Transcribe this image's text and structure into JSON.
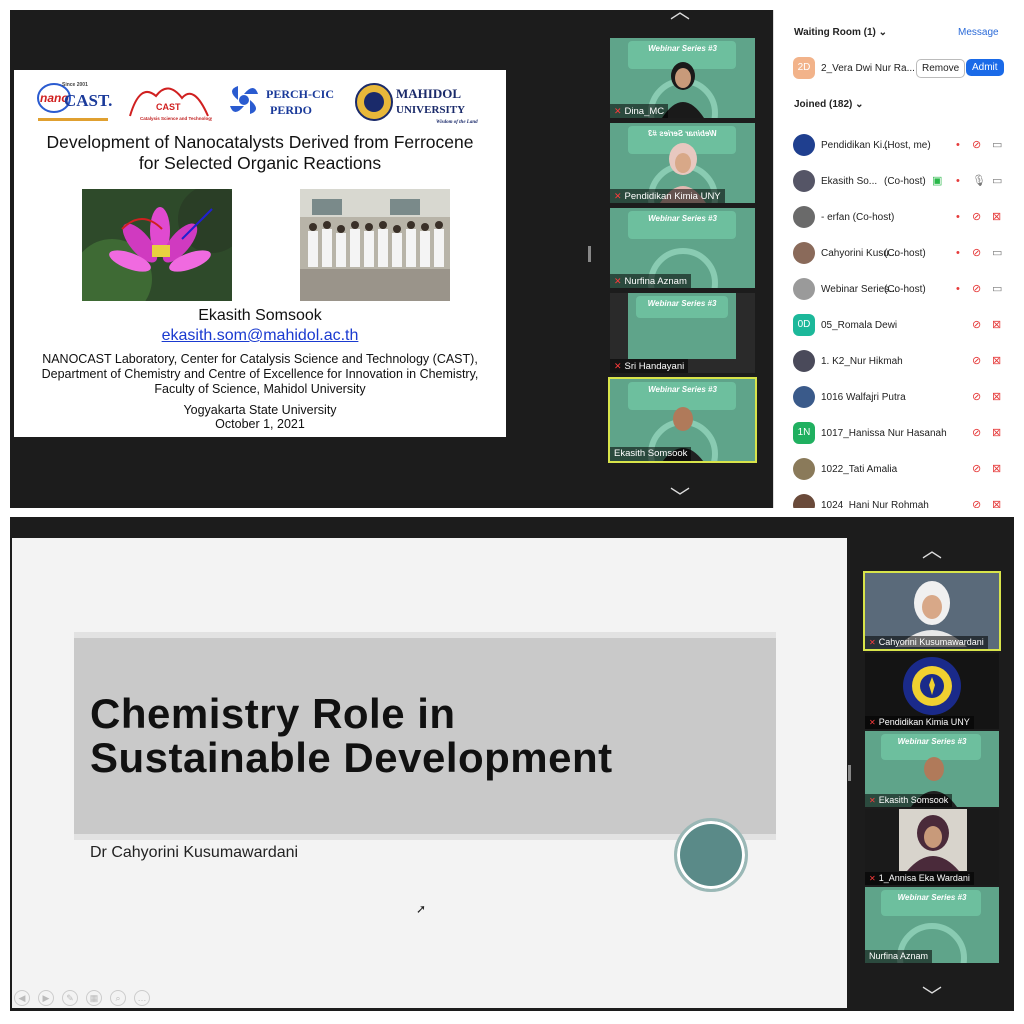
{
  "top": {
    "slide": {
      "logos": [
        "nano CAST.",
        "CAST",
        "PERCH-CIC",
        "PERDO",
        "MAHIDOL",
        "UNIVERSITY",
        "Wisdom of the Land"
      ],
      "title_line1": "Development of Nanocatalysts Derived from Ferrocene",
      "title_line2": "for Selected Organic Reactions",
      "author": "Ekasith Somsook",
      "email": "ekasith.som@mahidol.ac.th",
      "affil1": "NANOCAST Laboratory, Center for Catalysis Science and Technology (CAST),",
      "affil2": "Department of Chemistry and Centre of Excellence for Innovation in Chemistry,",
      "affil3": "Faculty of Science, Mahidol University",
      "venue": "Yogyakarta State University",
      "date": "October 1, 2021"
    },
    "tiles": [
      {
        "name": "Dina_MC"
      },
      {
        "name": "Pendidikan Kimia UNY"
      },
      {
        "name": "Nurfina Aznam"
      },
      {
        "name": "Sri Handayani"
      },
      {
        "name": "Ekasith Somsook"
      }
    ],
    "tile_banner": "Webinar Series #3",
    "panel": {
      "waiting_room": "Waiting Room (1)",
      "message": "Message",
      "waiting": {
        "initials": "2D",
        "name": "2_Vera Dwi Nur Ra...",
        "remove": "Remove",
        "admit": "Admit"
      },
      "joined": "Joined (182)",
      "participants": [
        {
          "initials": "",
          "name": "Pendidikan Ki...",
          "role": "(Host, me)",
          "color": "#1f3f8f"
        },
        {
          "initials": "",
          "name": "Ekasith So...",
          "role": "(Co-host)",
          "color": "#556"
        },
        {
          "initials": "",
          "name": "- erfan (Co-host)",
          "role": "",
          "color": "#6a6a6a"
        },
        {
          "initials": "",
          "name": "Cahyorini Kusu...",
          "role": "(Co-host)",
          "color": "#8a6a5a"
        },
        {
          "initials": "",
          "name": "Webinar Series...",
          "role": "(Co-host)",
          "color": "#9a9a9a"
        },
        {
          "initials": "0D",
          "name": "05_Romala Dewi",
          "role": "",
          "color": "#1cb89a"
        },
        {
          "initials": "",
          "name": "1. K2_Nur Hikmah",
          "role": "",
          "color": "#4a4a5a"
        },
        {
          "initials": "",
          "name": "1016 Walfajri Putra",
          "role": "",
          "color": "#3a5a8a"
        },
        {
          "initials": "1N",
          "name": "1017_Hanissa Nur Hasanah",
          "role": "",
          "color": "#20b060"
        },
        {
          "initials": "",
          "name": "1022_Tati Amalia",
          "role": "",
          "color": "#8a7a5a"
        },
        {
          "initials": "",
          "name": "1024_Hani Nur Rohmah",
          "role": "",
          "color": "#6a4a3a"
        }
      ]
    }
  },
  "bottom": {
    "slide": {
      "title_line1": "Chemistry Role in",
      "title_line2": "Sustainable Development",
      "author": "Dr Cahyorini Kusumawardani"
    },
    "tiles": [
      {
        "name": "Cahyorini Kusumawardani"
      },
      {
        "name": "Pendidikan Kimia UNY"
      },
      {
        "name": "Ekasith Somsook"
      },
      {
        "name": "1_Annisa Eka Wardani"
      },
      {
        "name": "Nurfina Aznam"
      }
    ],
    "tile_banner": "Webinar Series #3",
    "logo_text": "UNIVERSITAS NEGERI YOGYAKARTA"
  }
}
